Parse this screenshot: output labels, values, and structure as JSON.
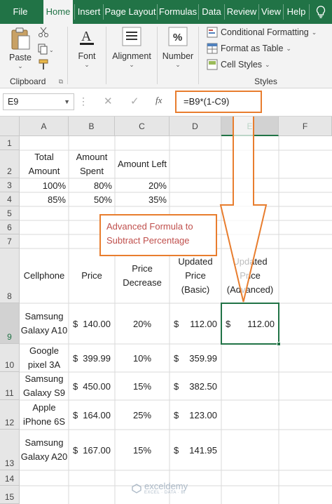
{
  "ribbon_tabs": [
    "File",
    "Home",
    "Insert",
    "Page Layout",
    "Formulas",
    "Data",
    "Review",
    "View",
    "Help"
  ],
  "active_tab": "Home",
  "help_icon": "lightbulb-icon",
  "clipboard": {
    "paste_label": "Paste",
    "group_label": "Clipboard"
  },
  "font_group": {
    "label": "Font"
  },
  "alignment_group": {
    "label": "Alignment"
  },
  "number_group": {
    "label": "Number"
  },
  "styles": {
    "conditional_formatting": "Conditional Formatting",
    "format_as_table": "Format as Table",
    "cell_styles": "Cell Styles",
    "group_label": "Styles"
  },
  "formula_bar": {
    "name_box": "E9",
    "fx": "fx",
    "formula": "=B9*(1-C9)"
  },
  "columns": [
    "A",
    "B",
    "C",
    "D",
    "E",
    "F"
  ],
  "selected_column": "E",
  "rows": [
    "1",
    "2",
    "3",
    "4",
    "5",
    "6",
    "7",
    "8",
    "9",
    "10",
    "11",
    "12",
    "13",
    "14",
    "15"
  ],
  "selected_row": "9",
  "cells": {
    "a2": "Total Amount",
    "b2": "Amount Spent",
    "c2": "Amount Left",
    "a3": "100%",
    "b3": "80%",
    "c3": "20%",
    "a4": "85%",
    "b4": "50%",
    "c4": "35%",
    "a8": "Cellphone",
    "b8": "Price",
    "c8": "Price Decrease",
    "d8": "Updated Price (Basic)",
    "e8": "Updated Price (Advanced)",
    "table": [
      {
        "phone": "Samsung Galaxy A10",
        "price_sym": "$",
        "price": "140.00",
        "decrease": "20%",
        "basic_sym": "$",
        "basic": "112.00",
        "adv_sym": "$",
        "adv": "112.00"
      },
      {
        "phone": "Google pixel 3A",
        "price_sym": "$",
        "price": "399.99",
        "decrease": "10%",
        "basic_sym": "$",
        "basic": "359.99"
      },
      {
        "phone": "Samsung Galaxy S9",
        "price_sym": "$",
        "price": "450.00",
        "decrease": "15%",
        "basic_sym": "$",
        "basic": "382.50"
      },
      {
        "phone": "Apple iPhone 6S",
        "price_sym": "$",
        "price": "164.00",
        "decrease": "25%",
        "basic_sym": "$",
        "basic": "123.00"
      },
      {
        "phone": "Samsung Galaxy A20",
        "price_sym": "$",
        "price": "167.00",
        "decrease": "15%",
        "basic_sym": "$",
        "basic": "141.95"
      }
    ]
  },
  "annotation": "Advanced Formula to Subtract Percentage",
  "watermark": {
    "name": "exceldemy",
    "tagline": "EXCEL · DATA · BI"
  },
  "colors": {
    "excel_green": "#217346",
    "callout_orange": "#e87d2e",
    "note_text": "#c0504d"
  }
}
